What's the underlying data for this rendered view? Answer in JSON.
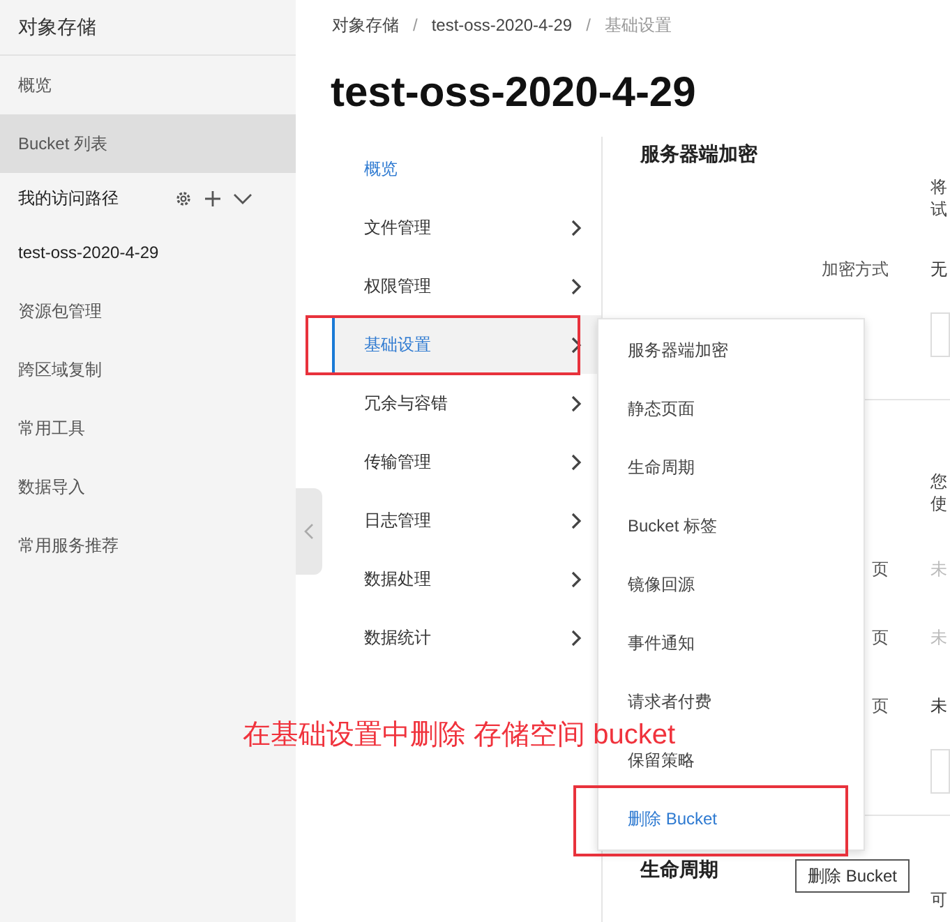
{
  "sidebar": {
    "title": "对象存储",
    "items": [
      {
        "label": "概览",
        "kind": "link",
        "selected": false
      },
      {
        "label": "Bucket 列表",
        "kind": "link",
        "selected": true
      },
      {
        "label": "我的访问路径",
        "kind": "section",
        "selected": false
      },
      {
        "label": "test-oss-2020-4-29",
        "kind": "bucket",
        "selected": false
      },
      {
        "label": "资源包管理",
        "kind": "link",
        "selected": false
      },
      {
        "label": "跨区域复制",
        "kind": "link",
        "selected": false
      },
      {
        "label": "常用工具",
        "kind": "link",
        "selected": false
      },
      {
        "label": "数据导入",
        "kind": "link",
        "selected": false
      },
      {
        "label": "常用服务推荐",
        "kind": "link",
        "selected": false
      }
    ]
  },
  "breadcrumb": [
    "对象存储",
    "test-oss-2020-4-29",
    "基础设置"
  ],
  "breadcrumb_separator": "/",
  "title": "test-oss-2020-4-29",
  "bucket_nav": [
    {
      "label": "概览",
      "kind": "link",
      "selected": false
    },
    {
      "label": "文件管理",
      "kind": "group",
      "selected": false
    },
    {
      "label": "权限管理",
      "kind": "group",
      "selected": false
    },
    {
      "label": "基础设置",
      "kind": "group",
      "selected": true
    },
    {
      "label": "冗余与容错",
      "kind": "group",
      "selected": false
    },
    {
      "label": "传输管理",
      "kind": "group",
      "selected": false
    },
    {
      "label": "日志管理",
      "kind": "group",
      "selected": false
    },
    {
      "label": "数据处理",
      "kind": "group",
      "selected": false
    },
    {
      "label": "数据统计",
      "kind": "group",
      "selected": false
    }
  ],
  "submenu": [
    {
      "label": "服务器端加密",
      "selected": false
    },
    {
      "label": "静态页面",
      "selected": false
    },
    {
      "label": "生命周期",
      "selected": false
    },
    {
      "label": "Bucket 标签",
      "selected": false
    },
    {
      "label": "镜像回源",
      "selected": false
    },
    {
      "label": "事件通知",
      "selected": false
    },
    {
      "label": "请求者付费",
      "selected": false
    },
    {
      "label": "保留策略",
      "selected": false
    },
    {
      "label": "删除 Bucket",
      "selected": true
    }
  ],
  "tooltip": "删除 Bucket",
  "sections": [
    {
      "title": "服务器端加密",
      "description": [
        "将",
        "试"
      ],
      "rows": [
        {
          "label": "加密方式",
          "value": "无",
          "disabled": false
        }
      ]
    },
    {
      "description": [
        "您",
        "使"
      ],
      "rows": [
        {
          "label": "页",
          "value": "未",
          "disabled": true
        },
        {
          "label": "页",
          "value": "未",
          "disabled": true
        },
        {
          "label": "页",
          "value": "未",
          "disabled": false
        }
      ]
    },
    {
      "title": "生命周期",
      "description": [
        "可"
      ]
    }
  ],
  "annotation": "在基础设置中删除 存储空间 bucket"
}
